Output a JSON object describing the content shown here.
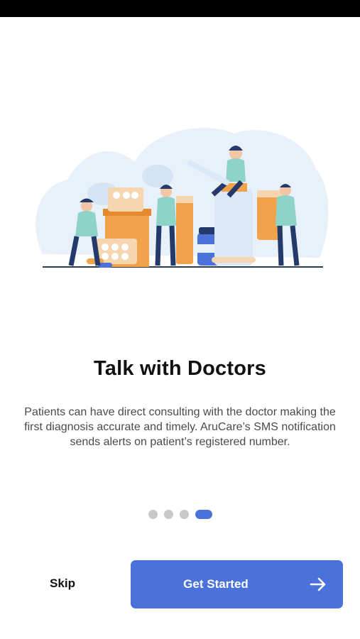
{
  "onboarding": {
    "title": "Talk with Doctors",
    "description": "Patients can have direct consulting with the doctor making the first diagnosis accurate and timely. AruCare’s SMS notification sends alerts on patient’s registered number.",
    "page_indicator": {
      "total": 4,
      "current": 4
    },
    "illustration": "doctors-and-medicine-illustration"
  },
  "actions": {
    "skip_label": "Skip",
    "primary_label": "Get Started",
    "primary_icon": "arrow-right-icon"
  },
  "colors": {
    "accent": "#4a72da",
    "dot_inactive": "#c8c8c8",
    "illustration_bg": "#e8f0fa",
    "orange": "#f0a34a",
    "teal": "#8ed3c8",
    "navy": "#233a6b"
  }
}
